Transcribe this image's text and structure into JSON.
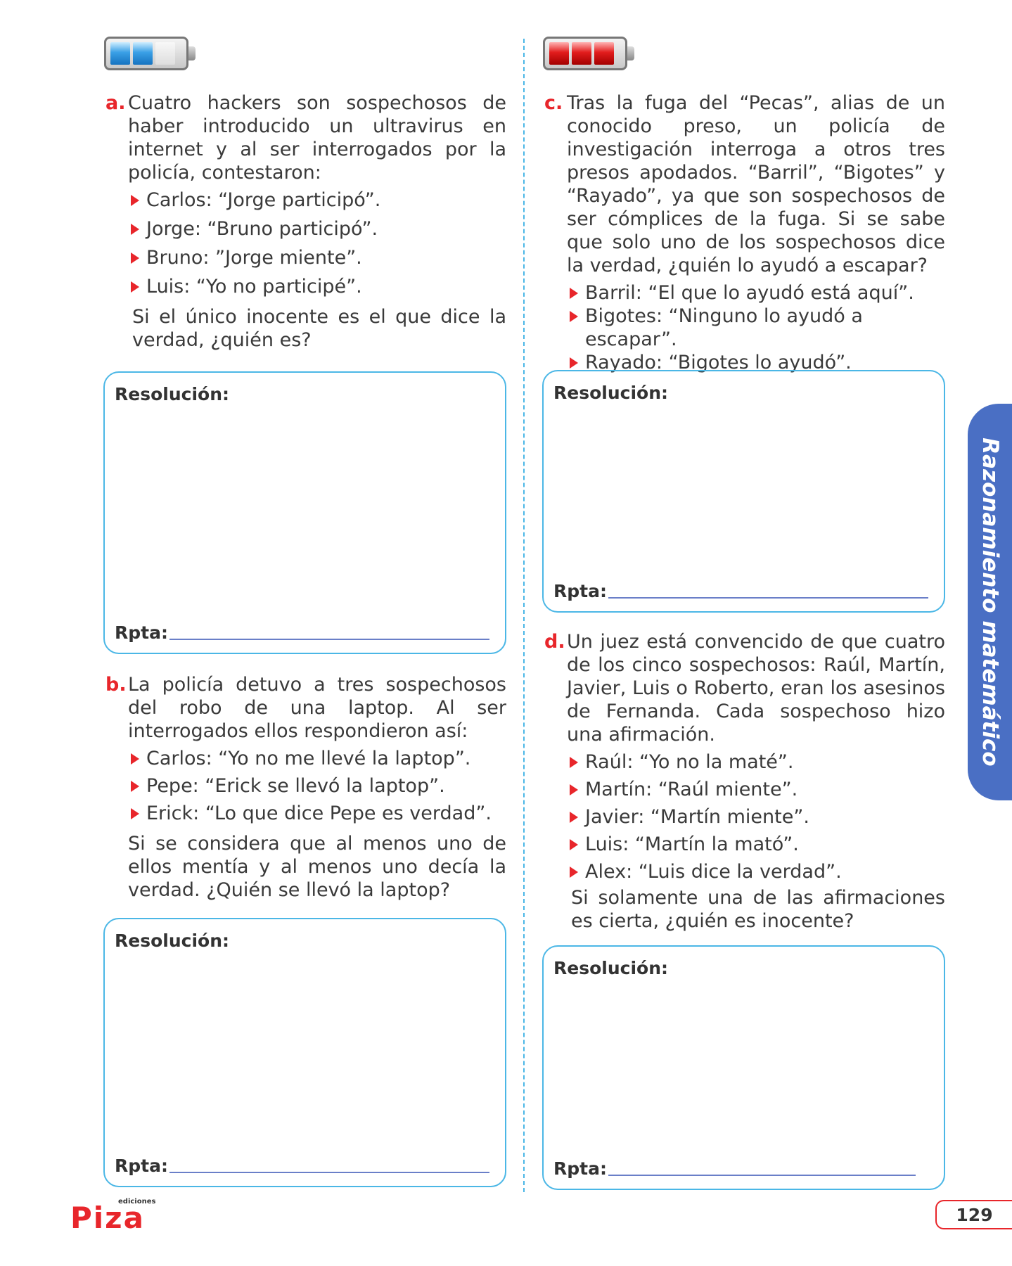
{
  "problems": {
    "a": {
      "letter": "a.",
      "text": "Cuatro hackers son sospechosos de haber introducido un ultravirus en internet y al ser interrogados por la policía, contestaron:",
      "items": [
        "Carlos: “Jorge participó”.",
        "Jorge: “Bruno participó”.",
        "Bruno: ”Jorge miente”.",
        "Luis: “Yo no participé”."
      ],
      "closing": "Si el único inocente es el que dice la verdad, ¿quién es?"
    },
    "b": {
      "letter": "b.",
      "text": "La policía detuvo a tres sospechosos del robo de una laptop. Al ser interrogados ellos respondieron así:",
      "items": [
        "Carlos: “Yo no me llevé la laptop”.",
        "Pepe: “Erick se llevó la laptop”.",
        "Erick: “Lo que dice Pepe es verdad”."
      ],
      "closing": "Si se considera que al menos uno de ellos mentía y al menos uno decía la verdad. ¿Quién se llevó la laptop?"
    },
    "c": {
      "letter": "c.",
      "text": "Tras la fuga del “Pecas”, alias de un conocido preso, un policía de investigación interroga a otros tres presos apodados. “Barril”, “Bigotes” y “Rayado”, ya que son sospechosos de ser cómplices de la fuga. Si se sabe que solo uno de los sospechosos dice la verdad, ¿quién lo ayudó a escapar?",
      "items": [
        "Barril: “El que lo ayudó está aquí”.",
        "Bigotes: “Ninguno lo ayudó a escapar”.",
        "Rayado: “Bigotes lo ayudó”."
      ]
    },
    "d": {
      "letter": "d.",
      "text": "Un juez está convencido de que cuatro de los cinco sospechosos: Raúl, Martín, Javier, Luis o Roberto, eran los asesinos de Fernanda. Cada sospechoso hizo una afirmación.",
      "items": [
        "Raúl: “Yo no la maté”.",
        "Martín: “Raúl miente”.",
        "Javier: “Martín miente”.",
        "Luis: “Martín la mató”.",
        "Alex: “Luis dice la verdad”."
      ],
      "closing": "Si solamente una de las afirmaciones es cierta, ¿quién es inocente?"
    }
  },
  "resolution_label": "Resolución:",
  "answer_label": "Rpta:",
  "side_tab": "Razonamiento matemático",
  "page_number": "129",
  "logo": {
    "brand": "Piza",
    "small": "ediciones"
  },
  "colors": {
    "accent": "#e8262b",
    "box_border": "#4bb7e6",
    "tab": "#4a6fc4"
  }
}
